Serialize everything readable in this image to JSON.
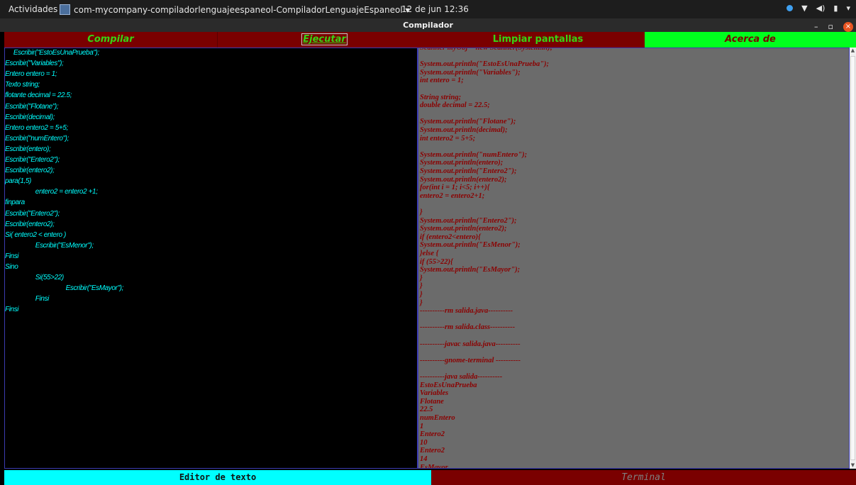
{
  "topbar": {
    "activities": "Actividades",
    "app_title": "com-mycompany-compiladorlenguajeespaneol-CompiladorLenguajeEspaneol ▾",
    "clock": "12 de jun  12:36",
    "tray_icons": [
      "network-icon",
      "volume-icon",
      "battery-icon",
      "menu-arrow-icon"
    ]
  },
  "window": {
    "title": "Compilador",
    "minimize": "–",
    "maximize": "▫",
    "close": "×"
  },
  "toolbar": {
    "compilar": "Compilar",
    "ejecutar": "Ejecutar",
    "limpiar": "Limpiar pantallas",
    "acerca": "Acerca de"
  },
  "editor_lines": [
    "     Escribir(\"EstoEsUnaPrueba\");",
    "Escribir(\"Variables\");",
    "Entero entero = 1;",
    "Texto string;",
    "flotante decimal = 22.5;",
    "Escribir(\"Flotane\");",
    "Escribir(decimal);",
    "Entero entero2 = 5+5;",
    "Escribir(\"numEntero\");",
    "Escribir(entero);",
    "Escribir(\"Entero2\");",
    "Escribir(entero2);",
    "para(1,5)",
    "                  entero2 = entero2 +1;",
    "finpara",
    "Escribir(\"Entero2\");",
    "Escribir(entero2);",
    "Si( entero2 < entero )",
    "                  Escribir(\"EsMenor\");",
    "Finsi",
    "Sino",
    "                  Si(55>22)",
    "                                    Escribir(\"EsMayor\");",
    "                  Finsi",
    "Finsi"
  ],
  "terminal_lines": [
    "Scanner myObj = new Scanner(System.in);",
    "",
    "System.out.println(\"EstoEsUnaPrueba\");",
    "System.out.println(\"Variables\");",
    "int entero = 1;",
    "",
    "String string;",
    "double decimal = 22.5;",
    "",
    "System.out.println(\"Flotane\");",
    "System.out.println(decimal);",
    "int entero2 = 5+5;",
    "",
    "System.out.println(\"numEntero\");",
    "System.out.println(entero);",
    "System.out.println(\"Entero2\");",
    "System.out.println(entero2);",
    "for(int i = 1; i<5; i++){",
    "entero2 = entero2+1;",
    "",
    "}",
    "System.out.println(\"Entero2\");",
    "System.out.println(entero2);",
    "if (entero2<entero){",
    "System.out.println(\"EsMenor\");",
    "}else {",
    "if (55>22){",
    "System.out.println(\"EsMayor\");",
    "}",
    "}",
    "}",
    "}",
    "----------rm salida.java----------",
    "",
    "----------rm salida.class----------",
    "",
    "----------javac salida.java----------",
    "",
    "----------gnome-terminal ----------",
    "",
    "----------java salida----------",
    "EstoEsUnaPrueba",
    "Variables",
    "Flotane",
    "22.5",
    "numEntero",
    "1",
    "Entero2",
    "10",
    "Entero2",
    "14",
    "EsMayor"
  ],
  "tabs": {
    "editor": "Editor de texto",
    "terminal": "Terminal"
  },
  "colors": {
    "toolbar_bg": "#7a0000",
    "toolbar_text": "#37d414",
    "acerca_bg": "#00ff1e",
    "editor_text": "#00ffff",
    "terminal_bg": "#6b6b6b",
    "terminal_text": "#8b0000"
  }
}
